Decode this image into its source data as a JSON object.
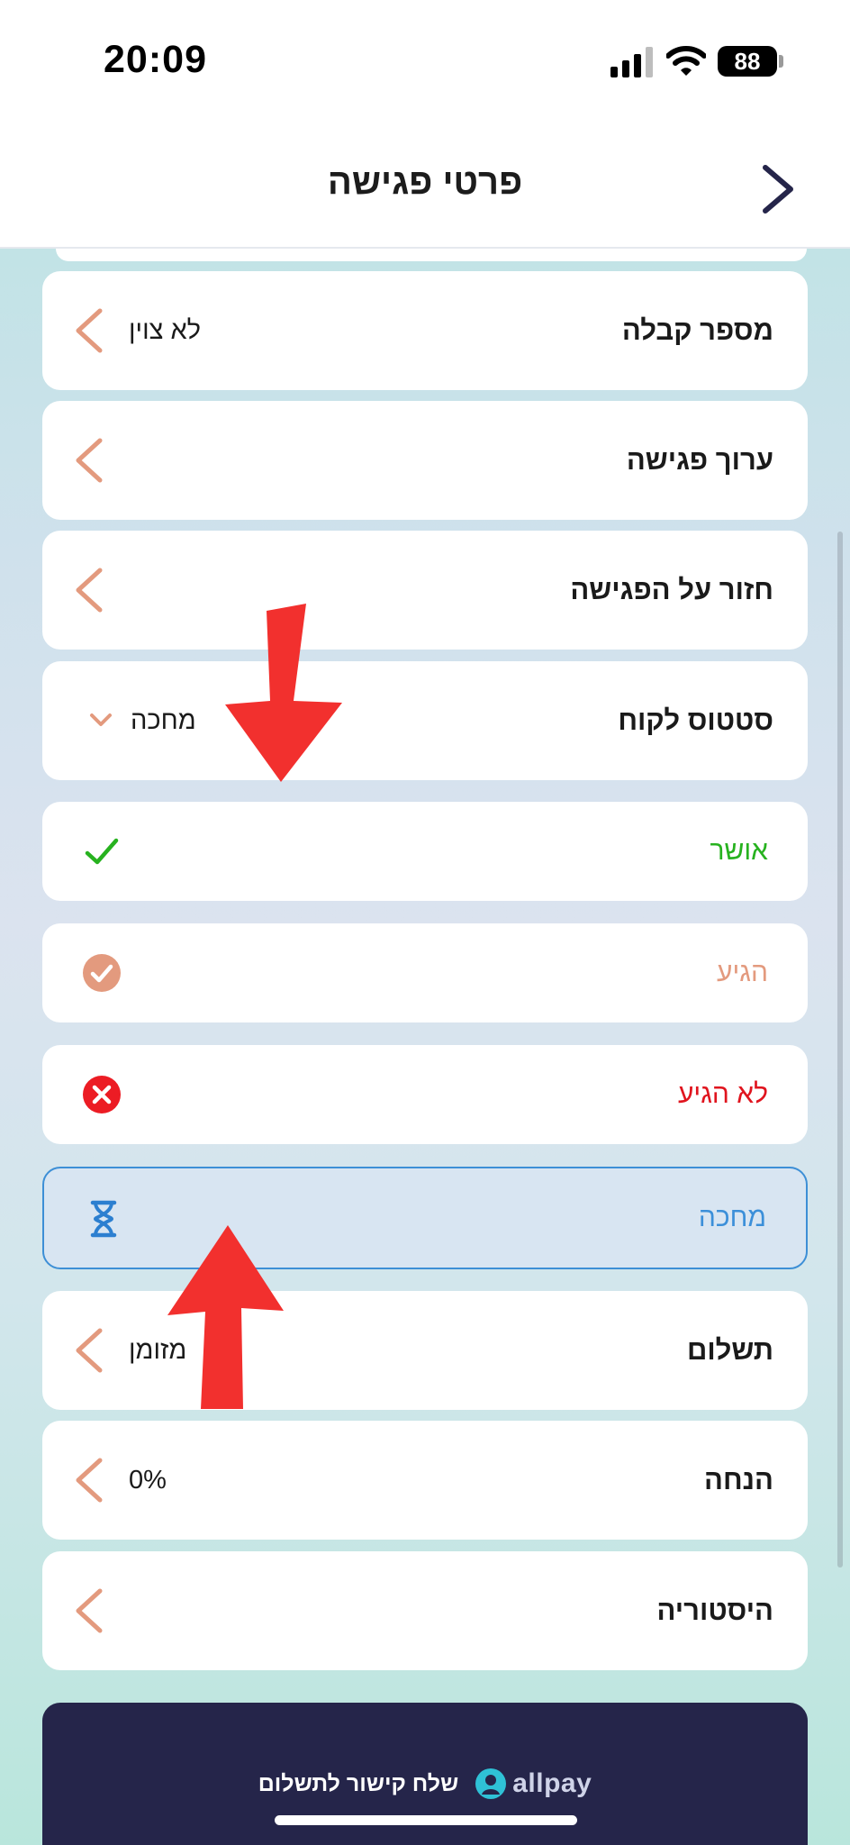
{
  "status_bar": {
    "time": "20:09",
    "battery": "88"
  },
  "header": {
    "title": "פרטי פגישה",
    "back_icon": "chevron-right-icon"
  },
  "rows": [
    {
      "label": "מספר קבלה",
      "value": "לא צוין"
    },
    {
      "label": "ערוך פגישה",
      "value": ""
    },
    {
      "label": "חזור על הפגישה",
      "value": ""
    },
    {
      "label": "סטטוס לקוח",
      "value": "מחכה"
    }
  ],
  "status_options": [
    {
      "label": "אושר",
      "color": "#27b21f",
      "icon": "checkmark-icon"
    },
    {
      "label": "הגיע",
      "color": "#e39a7e",
      "icon": "check-circle-icon"
    },
    {
      "label": "לא הגיע",
      "color": "#e0141e",
      "icon": "x-circle-icon"
    },
    {
      "label": "מחכה",
      "color": "#3b8fd9",
      "icon": "hourglass-icon",
      "selected": true
    }
  ],
  "bottom_rows": [
    {
      "label": "תשלום",
      "value": "מזומן"
    },
    {
      "label": "הנחה",
      "value": "0%"
    },
    {
      "label": "היסטוריה",
      "value": ""
    }
  ],
  "allpay": {
    "brand": "allpay",
    "text": "שלח קישור לתשלום"
  },
  "colors": {
    "accent": "#e39a7e",
    "dark_card": "#25254a",
    "arrow": "#f2302e"
  }
}
